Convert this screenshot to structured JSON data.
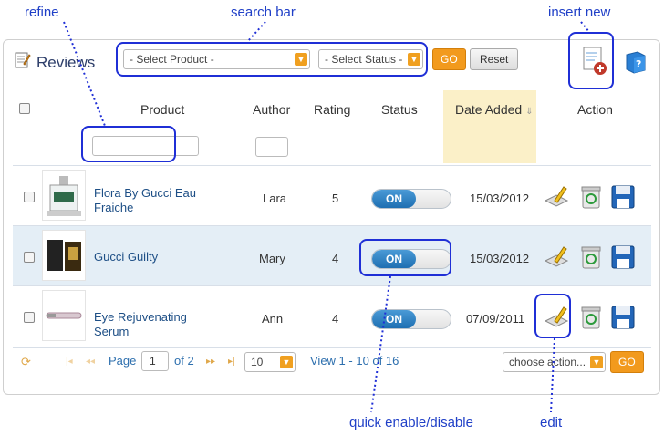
{
  "annotations": {
    "refine": "refine",
    "search_bar": "search bar",
    "insert_new": "insert new",
    "quick_toggle": "quick enable/disable",
    "edit": "edit"
  },
  "panel": {
    "title": "Reviews"
  },
  "filters": {
    "product_select": "- Select Product -",
    "status_select": "- Select Status -",
    "go_label": "GO",
    "reset_label": "Reset"
  },
  "table": {
    "headers": {
      "product": "Product",
      "author": "Author",
      "rating": "Rating",
      "status": "Status",
      "date_added": "Date Added",
      "action": "Action"
    },
    "rows": [
      {
        "product": "Flora By Gucci Eau Fraiche",
        "author": "Lara",
        "rating": "5",
        "status": "ON",
        "date": "15/03/2012"
      },
      {
        "product": "Gucci Guilty",
        "author": "Mary",
        "rating": "4",
        "status": "ON",
        "date": "15/03/2012"
      },
      {
        "product": "Eye Rejuvenating Serum",
        "author": "Ann",
        "rating": "4",
        "status": "ON",
        "date": "07/09/2011"
      }
    ]
  },
  "pager": {
    "page_label": "Page",
    "page_value": "1",
    "of_label": "of 2",
    "per_page": "10",
    "view_text": "View 1 - 10 of 16",
    "bulk_select": "choose action...",
    "go_label": "GO"
  },
  "colors": {
    "accent": "#f29a1d",
    "annotation": "#1f2fd6",
    "link": "#1e4f86",
    "date_highlight": "#fbf0c8",
    "row_alt": "#e4eef6"
  }
}
